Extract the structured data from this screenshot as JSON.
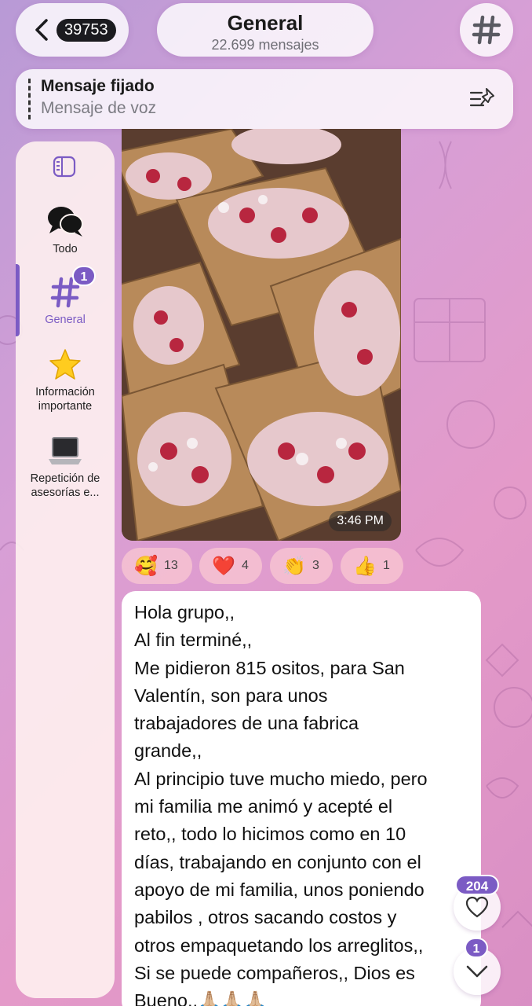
{
  "header": {
    "back_count": "39753",
    "title": "General",
    "subtitle": "22.699 mensajes"
  },
  "pinned": {
    "title": "Mensaje fijado",
    "subtitle": "Mensaje de voz"
  },
  "sidebar": {
    "items": [
      {
        "label": "Todo",
        "icon": "chat-bubbles-icon"
      },
      {
        "label": "General",
        "icon": "hash-icon",
        "badge": "1",
        "active": true
      },
      {
        "label": "Información importante",
        "icon": "star-icon"
      },
      {
        "label": "Repetición de asesorías e...",
        "icon": "laptop-icon"
      }
    ],
    "labels_split": {
      "info_1": "Información",
      "info_2": "importante",
      "rep_1": "Repetición de",
      "rep_2": "asesorías e..."
    }
  },
  "photo": {
    "timestamp": "3:46 PM"
  },
  "reactions": [
    {
      "emoji": "🥰",
      "count": "13"
    },
    {
      "emoji": "❤️",
      "count": "4"
    },
    {
      "emoji": "👏",
      "count": "3"
    },
    {
      "emoji": "👍",
      "count": "1"
    }
  ],
  "message": {
    "lines": [
      "Hola grupo,,",
      "Al fin terminé,,",
      "Me pidieron 815 ositos, para San",
      "Valentín, son para unos",
      "trabajadores de una fabrica",
      "grande,,",
      "Al principio tuve mucho miedo, pero",
      "mi familia me animó y acepté el",
      "reto,, todo lo hicimos como en 10",
      "días, trabajando en conjunto con el",
      "apoyo de mi familia, unos poniendo",
      "pabilos , otros sacando costos y",
      "otros empaquetando los arreglitos,,",
      "Si se puede compañeros,, Dios es",
      "Bueno,,🙏🏼🙏🏼🙏🏼"
    ]
  },
  "floating": {
    "reactions_badge": "204",
    "mentions_badge": "1"
  },
  "colors": {
    "accent": "#7b5bc4",
    "bubble": "#ffffff",
    "reaction_bg": "#f7c6d2"
  }
}
